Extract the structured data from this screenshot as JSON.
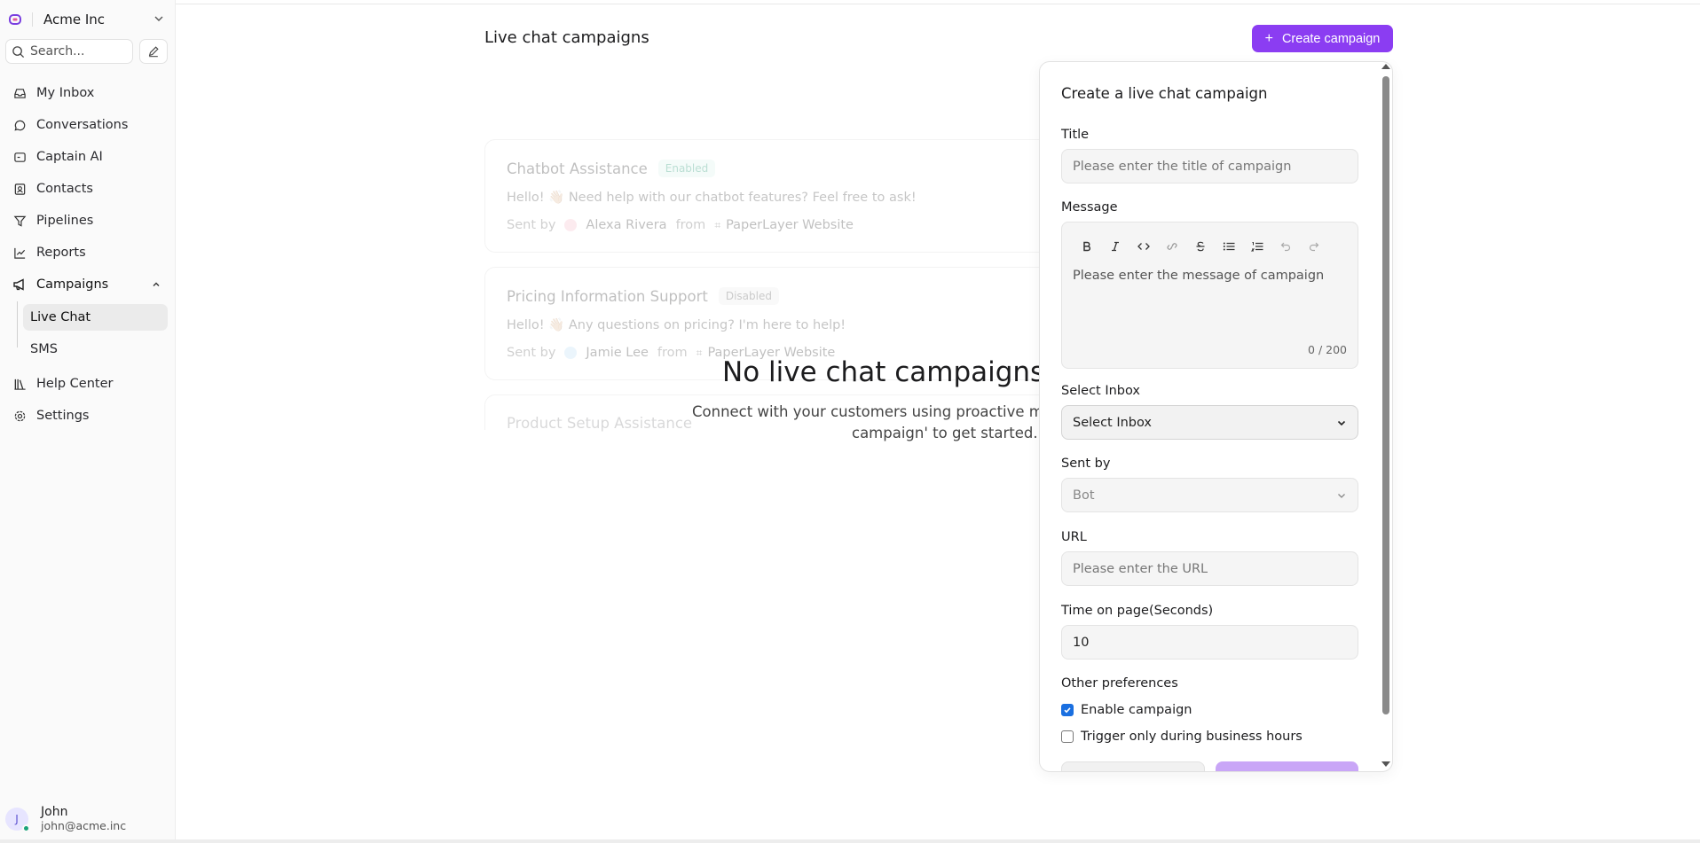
{
  "colors": {
    "accent": "#8b3df2",
    "success": "#1aa37a",
    "enabled_badge": "#0d8c64"
  },
  "sidebar": {
    "org_name": "Acme Inc",
    "search_placeholder": "Search...",
    "nav": [
      {
        "label": "My Inbox",
        "icon": "inbox-icon"
      },
      {
        "label": "Conversations",
        "icon": "chat-bubble-icon"
      },
      {
        "label": "Captain AI",
        "icon": "bot-icon"
      },
      {
        "label": "Contacts",
        "icon": "contact-card-icon"
      },
      {
        "label": "Pipelines",
        "icon": "funnel-icon"
      },
      {
        "label": "Reports",
        "icon": "chart-line-icon"
      },
      {
        "label": "Campaigns",
        "icon": "megaphone-icon"
      }
    ],
    "campaigns_sub": [
      {
        "label": "Live Chat",
        "active": true
      },
      {
        "label": "SMS",
        "active": false
      }
    ],
    "nav_bottom": [
      {
        "label": "Help Center",
        "icon": "library-icon"
      },
      {
        "label": "Settings",
        "icon": "gear-icon"
      }
    ],
    "user": {
      "initial": "J",
      "name": "John",
      "email": "john@acme.inc"
    }
  },
  "main": {
    "title": "Live chat campaigns",
    "create_button": "Create campaign",
    "cards": [
      {
        "title": "Chatbot Assistance",
        "status": "Enabled",
        "message": "Hello! 👋🏼 Need help with our chatbot features? Feel free to ask!",
        "sent_by_label": "Sent by",
        "sender": "Alexa Rivera",
        "from_label": "from",
        "inbox": "PaperLayer Website"
      },
      {
        "title": "Pricing Information Support",
        "status": "Disabled",
        "message": "Hello! 👋🏼 Any questions on pricing? I'm here to help!",
        "sent_by_label": "Sent by",
        "sender": "Jamie Lee",
        "from_label": "from",
        "inbox": "PaperLayer Website"
      },
      {
        "title": "Product Setup Assistance"
      }
    ],
    "empty_title": "No live chat campaigns are",
    "empty_desc_line1": "Connect with your customers using proactive mes",
    "empty_desc_line2": "campaign' to get started."
  },
  "panel": {
    "title": "Create a live chat campaign",
    "title_label": "Title",
    "title_placeholder": "Please enter the title of campaign",
    "message_label": "Message",
    "message_placeholder": "Please enter the message of campaign",
    "message_counter": "0 / 200",
    "inbox_label": "Select Inbox",
    "inbox_value": "Select Inbox",
    "sent_by_label": "Sent by",
    "sent_by_value": "Bot",
    "url_label": "URL",
    "url_placeholder": "Please enter the URL",
    "time_label": "Time on page(Seconds)",
    "time_value": "10",
    "prefs_label": "Other preferences",
    "enable_campaign": "Enable campaign",
    "enable_campaign_checked": true,
    "business_hours": "Trigger only during business hours",
    "business_hours_checked": false
  }
}
